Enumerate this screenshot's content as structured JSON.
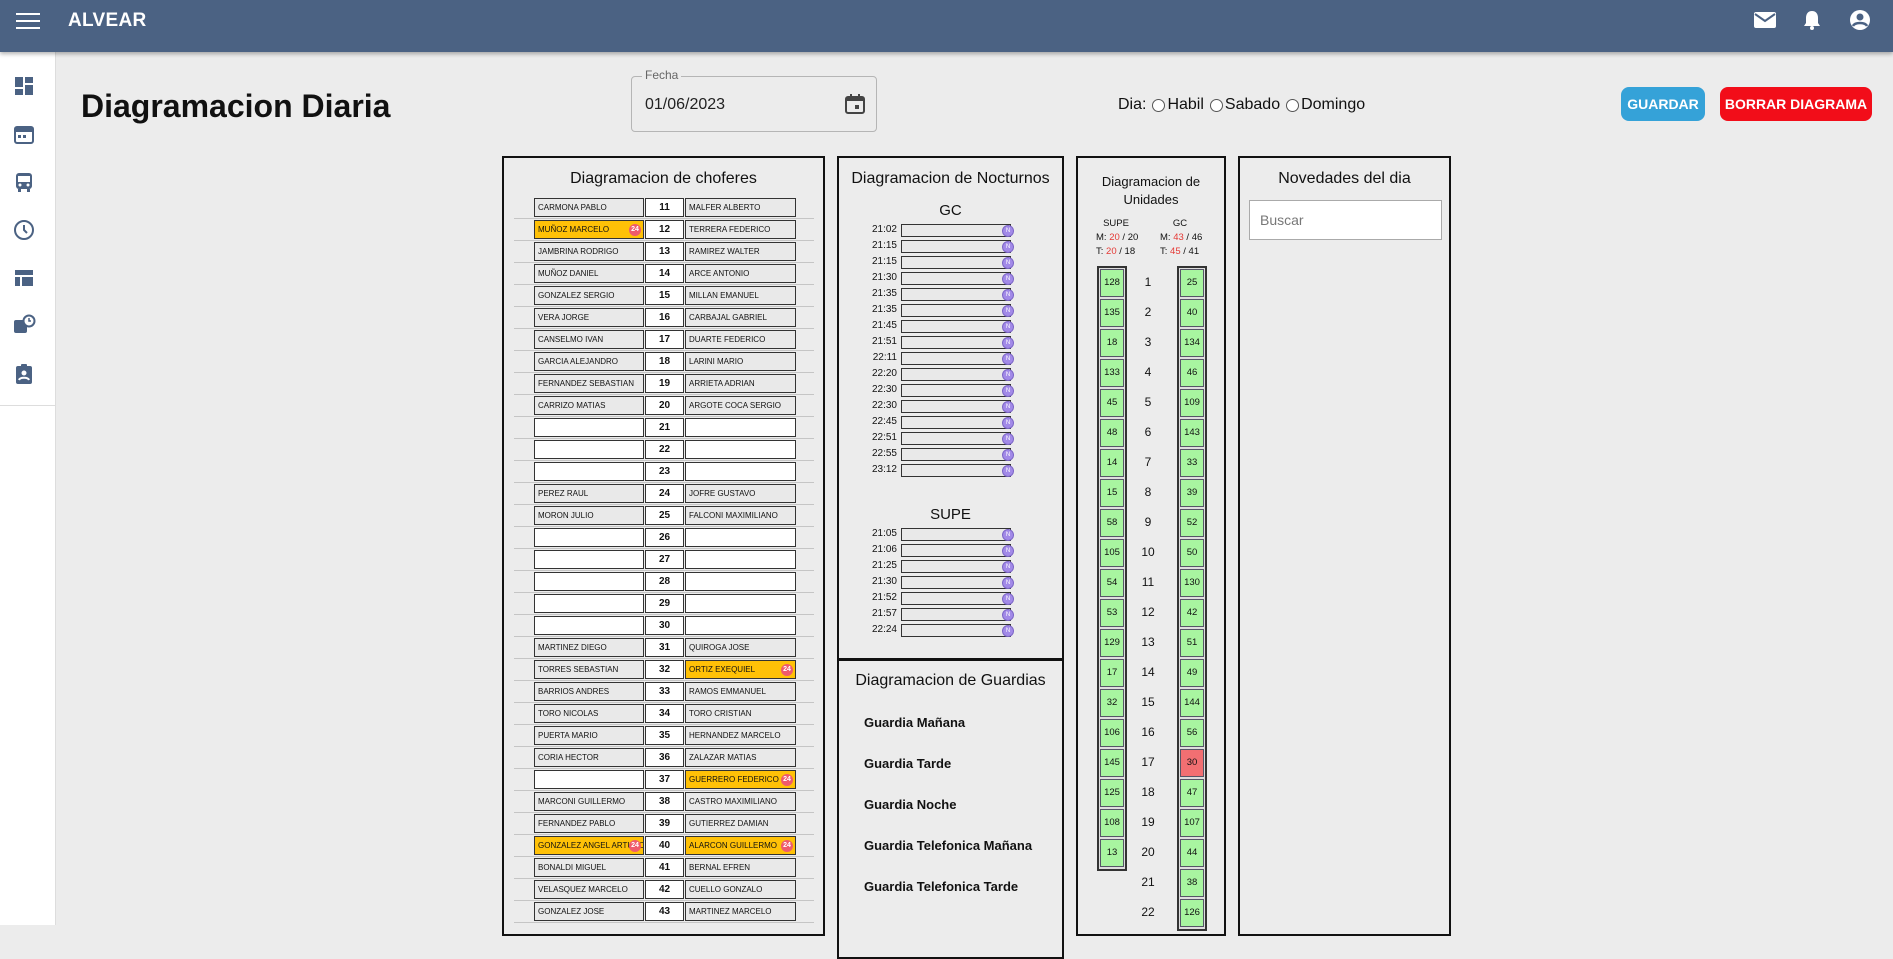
{
  "app": {
    "brand": "ALVEAR"
  },
  "page": {
    "title": "Diagramacion Diaria"
  },
  "fecha": {
    "label": "Fecha",
    "value": "01/06/2023"
  },
  "dia": {
    "label": "Dia:",
    "options": [
      "Habil",
      "Sabado",
      "Domingo"
    ]
  },
  "buttons": {
    "guardar": "GUARDAR",
    "borrar": "BORRAR DIAGRAMA"
  },
  "choferes": {
    "title": "Diagramacion de choferes",
    "rows": [
      {
        "n": "11",
        "l": "CARMONA PABLO",
        "r": "MALFER ALBERTO"
      },
      {
        "n": "12",
        "l": "MUÑOZ MARCELO",
        "r": "TERRERA FEDERICO",
        "lh": true
      },
      {
        "n": "13",
        "l": "JAMBRINA RODRIGO",
        "r": "RAMIREZ WALTER"
      },
      {
        "n": "14",
        "l": "MUÑOZ DANIEL",
        "r": "ARCE ANTONIO"
      },
      {
        "n": "15",
        "l": "GONZALEZ SERGIO",
        "r": "MILLAN EMANUEL"
      },
      {
        "n": "16",
        "l": "VERA JORGE",
        "r": "CARBAJAL GABRIEL"
      },
      {
        "n": "17",
        "l": "CANSELMO IVAN",
        "r": "DUARTE FEDERICO"
      },
      {
        "n": "18",
        "l": "GARCIA ALEJANDRO",
        "r": "LARINI MARIO"
      },
      {
        "n": "19",
        "l": "FERNANDEZ SEBASTIAN",
        "r": "ARRIETA ADRIAN"
      },
      {
        "n": "20",
        "l": "CARRIZO MATIAS",
        "r": "ARGOTE COCA SERGIO"
      },
      {
        "n": "21",
        "l": "",
        "r": ""
      },
      {
        "n": "22",
        "l": "",
        "r": ""
      },
      {
        "n": "23",
        "l": "",
        "r": ""
      },
      {
        "n": "24",
        "l": "PEREZ RAUL",
        "r": "JOFRE GUSTAVO"
      },
      {
        "n": "25",
        "l": "MORON JULIO",
        "r": "FALCONI MAXIMILIANO"
      },
      {
        "n": "26",
        "l": "",
        "r": ""
      },
      {
        "n": "27",
        "l": "",
        "r": ""
      },
      {
        "n": "28",
        "l": "",
        "r": ""
      },
      {
        "n": "29",
        "l": "",
        "r": ""
      },
      {
        "n": "30",
        "l": "",
        "r": ""
      },
      {
        "n": "31",
        "l": "MARTINEZ DIEGO",
        "r": "QUIROGA JOSE"
      },
      {
        "n": "32",
        "l": "TORRES SEBASTIAN",
        "r": "ORTIZ EXEQUIEL",
        "rh": true
      },
      {
        "n": "33",
        "l": "BARRIOS ANDRES",
        "r": "RAMOS EMMANUEL"
      },
      {
        "n": "34",
        "l": "TORO NICOLAS",
        "r": "TORO CRISTIAN"
      },
      {
        "n": "35",
        "l": "PUERTA MARIO",
        "r": "HERNANDEZ MARCELO"
      },
      {
        "n": "36",
        "l": "CORIA HECTOR",
        "r": "ZALAZAR MATIAS"
      },
      {
        "n": "37",
        "l": "",
        "r": "GUERRERO FEDERICO",
        "rh": true
      },
      {
        "n": "38",
        "l": "MARCONI GUILLERMO",
        "r": "CASTRO MAXIMILIANO"
      },
      {
        "n": "39",
        "l": "FERNANDEZ PABLO",
        "r": "GUTIERREZ DAMIAN"
      },
      {
        "n": "40",
        "l": "GONZALEZ ANGEL ARTURO",
        "r": "ALARCON GUILLERMO",
        "lh": true,
        "rh": true
      },
      {
        "n": "41",
        "l": "BONALDI MIGUEL",
        "r": "BERNAL EFREN"
      },
      {
        "n": "42",
        "l": "VELASQUEZ MARCELO",
        "r": "CUELLO GONZALO"
      },
      {
        "n": "43",
        "l": "GONZALEZ JOSE",
        "r": "MARTINEZ MARCELO"
      }
    ],
    "badge": "24"
  },
  "nocturnos": {
    "title": "Diagramacion de Nocturnos",
    "gc_label": "GC",
    "gc": [
      "21:02",
      "21:15",
      "21:15",
      "21:30",
      "21:35",
      "21:35",
      "21:45",
      "21:51",
      "22:11",
      "22:20",
      "22:30",
      "22:30",
      "22:45",
      "22:51",
      "22:55",
      "23:12"
    ],
    "supe_label": "SUPE",
    "supe": [
      "21:05",
      "21:06",
      "21:25",
      "21:30",
      "21:52",
      "21:57",
      "22:24"
    ],
    "tag": "N"
  },
  "guardias": {
    "title": "Diagramacion de Guardias",
    "items": [
      "Guardia Mañana",
      "Guardia Tarde",
      "Guardia Noche",
      "Guardia Telefonica Mañana",
      "Guardia Telefonica Tarde"
    ]
  },
  "unidades": {
    "title_1": "Diagramacion de",
    "title_2": "Unidades",
    "supe": {
      "label": "SUPE",
      "m_prefix": "M:",
      "m_a": "20",
      "m_b": "20",
      "t_prefix": "T:",
      "t_a": "20",
      "t_b": "18"
    },
    "gc": {
      "label": "GC",
      "m_prefix": "M:",
      "m_a": "43",
      "m_b": "46",
      "t_prefix": "T:",
      "t_a": "45",
      "t_b": "41"
    },
    "numbers": [
      "1",
      "2",
      "3",
      "4",
      "5",
      "6",
      "7",
      "8",
      "9",
      "10",
      "11",
      "12",
      "13",
      "14",
      "15",
      "16",
      "17",
      "18",
      "19",
      "20",
      "21",
      "22"
    ],
    "supe_units": [
      "128",
      "135",
      "18",
      "133",
      "45",
      "48",
      "14",
      "15",
      "58",
      "105",
      "54",
      "53",
      "129",
      "17",
      "32",
      "106",
      "145",
      "125",
      "108",
      "13"
    ],
    "gc_units": [
      "25",
      "40",
      "134",
      "46",
      "109",
      "143",
      "33",
      "39",
      "52",
      "50",
      "130",
      "42",
      "51",
      "49",
      "144",
      "56",
      "30",
      "47",
      "107",
      "44",
      "38",
      "126"
    ],
    "gc_red_index": 16,
    "sep": "/"
  },
  "novedades": {
    "title": "Novedades del dia",
    "search_placeholder": "Buscar"
  }
}
